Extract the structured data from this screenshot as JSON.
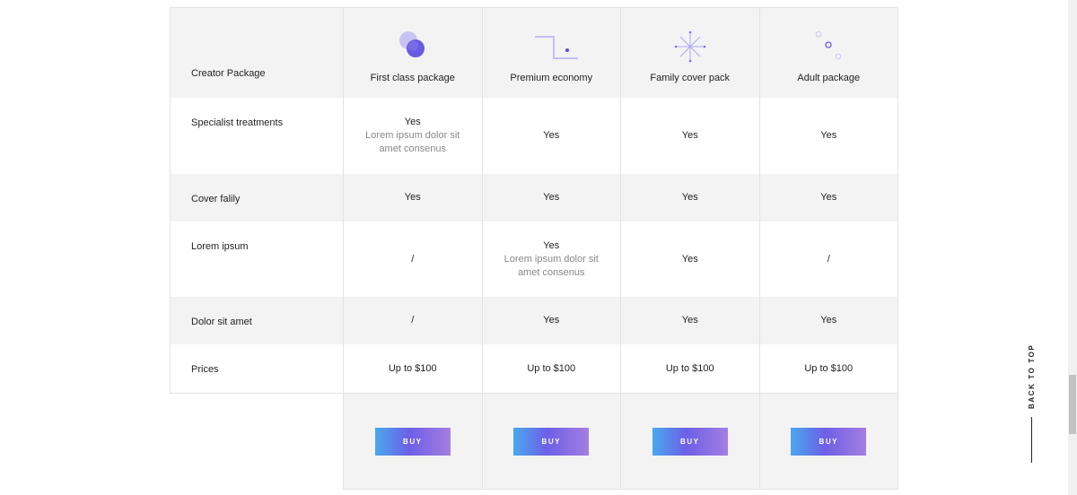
{
  "table": {
    "header": {
      "label": "Creator Package",
      "plans": [
        {
          "name": "First class package",
          "icon": "overlapping-circles-icon"
        },
        {
          "name": "Premium economy",
          "icon": "step-line-dot-icon"
        },
        {
          "name": "Family cover pack",
          "icon": "starburst-icon"
        },
        {
          "name": "Adult package",
          "icon": "diagonal-dots-icon"
        }
      ]
    },
    "rows": [
      {
        "label": "Specialist treatments",
        "values": [
          {
            "main": "Yes",
            "sub": "Lorem ipsum dolor sit amet consenus"
          },
          {
            "main": "Yes",
            "sub": ""
          },
          {
            "main": "Yes",
            "sub": ""
          },
          {
            "main": "Yes",
            "sub": ""
          }
        ]
      },
      {
        "label": "Cover falily",
        "values": [
          {
            "main": "Yes",
            "sub": ""
          },
          {
            "main": "Yes",
            "sub": ""
          },
          {
            "main": "Yes",
            "sub": ""
          },
          {
            "main": "Yes",
            "sub": ""
          }
        ]
      },
      {
        "label": "Lorem ipsum",
        "values": [
          {
            "main": "/",
            "sub": ""
          },
          {
            "main": "Yes",
            "sub": "Lorem ipsum dolor sit amet consenus"
          },
          {
            "main": "Yes",
            "sub": ""
          },
          {
            "main": "/",
            "sub": ""
          }
        ]
      },
      {
        "label": "Dolor sit amet",
        "values": [
          {
            "main": "/",
            "sub": ""
          },
          {
            "main": "Yes",
            "sub": ""
          },
          {
            "main": "Yes",
            "sub": ""
          },
          {
            "main": "Yes",
            "sub": ""
          }
        ]
      },
      {
        "label": "Prices",
        "values": [
          {
            "main": "Up to $100",
            "sub": ""
          },
          {
            "main": "Up to $100",
            "sub": ""
          },
          {
            "main": "Up to $100",
            "sub": ""
          },
          {
            "main": "Up to $100",
            "sub": ""
          }
        ]
      }
    ],
    "buy_label": "BUY"
  },
  "back_to_top": "BACK TO TOP",
  "colors": {
    "accent_start": "#4aa8ee",
    "accent_mid": "#6d5fe6",
    "accent_end": "#a47ee2",
    "row_gray": "#f3f3f3",
    "muted_text": "#888888"
  }
}
